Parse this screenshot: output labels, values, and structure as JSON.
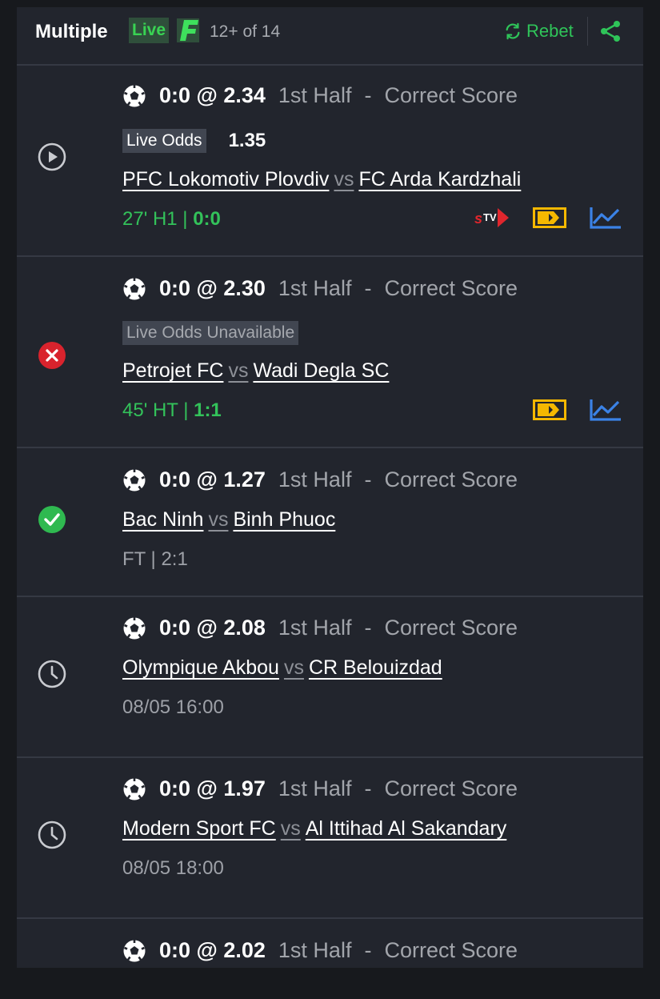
{
  "header": {
    "title": "Multiple",
    "live_label": "Live",
    "count": "12+ of 14",
    "rebet_label": "Rebet"
  },
  "colors": {
    "background": "#22252d",
    "live_green": "#33c25a",
    "lost_red": "#d9232d",
    "won_green": "#2fb950",
    "stream_yellow": "#f5b800",
    "stats_blue": "#3b82e6",
    "stv_red": "#e0262d"
  },
  "bets": [
    {
      "status": "play-icon",
      "selection": "0:0 @ 2.34",
      "period": "1st Half",
      "sep": "-",
      "market": "Correct Score",
      "live_odds_label": "Live Odds",
      "live_odds_value": "1.35",
      "home": "PFC Lokomotiv Plovdiv",
      "vs": "vs",
      "away": "FC Arda Kardzhali",
      "time": "27' H1",
      "pipe": "|",
      "score": "0:0",
      "icons": [
        "stv-icon",
        "stream-icon",
        "stats-icon"
      ]
    },
    {
      "status": "lost-icon",
      "selection": "0:0 @ 2.30",
      "period": "1st Half",
      "sep": "-",
      "market": "Correct Score",
      "live_odds_label": "Live Odds Unavailable",
      "home": "Petrojet FC",
      "vs": "vs",
      "away": "Wadi Degla SC",
      "time": "45' HT",
      "pipe": "|",
      "score": "1:1",
      "icons": [
        "stream-icon",
        "stats-icon"
      ]
    },
    {
      "status": "won-icon",
      "selection": "0:0 @ 1.27",
      "period": "1st Half",
      "sep": "-",
      "market": "Correct Score",
      "home": "Bac Ninh",
      "vs": "vs",
      "away": "Binh Phuoc",
      "result": "FT | 2:1"
    },
    {
      "status": "clock-icon",
      "selection": "0:0 @ 2.08",
      "period": "1st Half",
      "sep": "-",
      "market": "Correct Score",
      "home": "Olympique Akbou",
      "vs": "vs",
      "away": "CR Belouizdad",
      "kickoff": "08/05 16:00"
    },
    {
      "status": "clock-icon",
      "selection": "0:0 @ 1.97",
      "period": "1st Half",
      "sep": "-",
      "market": "Correct Score",
      "home": "Modern Sport FC",
      "vs": "vs",
      "away": "Al Ittihad Al Sakandary",
      "kickoff": "08/05 18:00"
    },
    {
      "selection": "0:0 @ 2.02",
      "period": "1st Half",
      "sep": "-",
      "market": "Correct Score"
    }
  ]
}
